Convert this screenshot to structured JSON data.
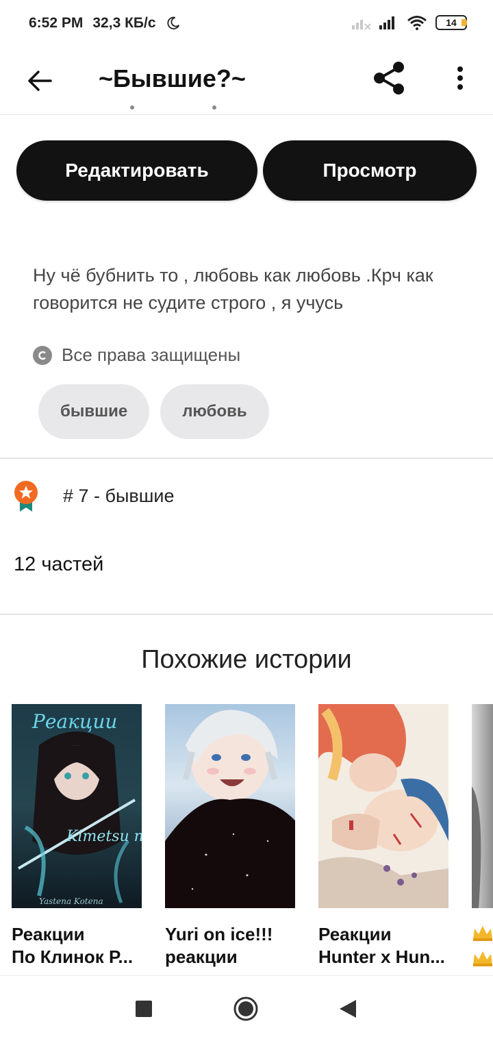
{
  "status_bar": {
    "time": "6:52 PM",
    "speed": "32,3 КБ/с",
    "battery": "14"
  },
  "app_bar": {
    "title": "~Бывшие?~"
  },
  "actions": {
    "edit_label": "Редактировать",
    "view_label": "Просмотр"
  },
  "story": {
    "description": "Ну чё бубнить то , любовь как любовь .Крч как говорится не судите строго , я учусь",
    "copyright": "Все права защищены",
    "tags": [
      "бывшие",
      "любовь"
    ],
    "ranking": "# 7 - бывшие",
    "parts": "12 частей"
  },
  "similar": {
    "heading": "Похожие истории",
    "items": [
      {
        "line1": "Реакции",
        "line2": "По Клинок Р...",
        "cover_text": "Реакции",
        "cover_subtext": "Kimetsu no Yaiba",
        "cover_credit": "Yastena Kotena"
      },
      {
        "line1": "Yuri on ice!!!",
        "line2": "реакции"
      },
      {
        "line1": "Реакции",
        "line2": "Hunter x Hun..."
      }
    ]
  },
  "colors": {
    "primary_button": "#121212",
    "tag_background": "#e8e8ea",
    "ranking_badge": "#f26a21",
    "ranking_ribbon": "#1d8a7a"
  }
}
